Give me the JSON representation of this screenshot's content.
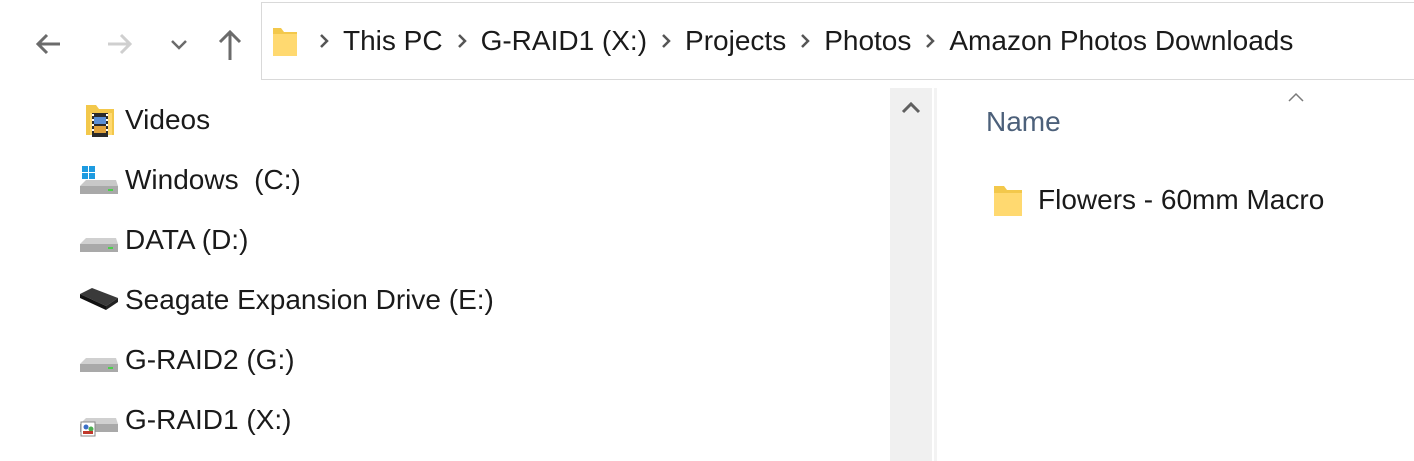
{
  "toolbar": {
    "back_icon": "arrow-left-icon",
    "forward_icon": "arrow-right-icon",
    "recent_icon": "chevron-down-icon",
    "up_icon": "arrow-up-icon"
  },
  "address": {
    "icon": "folder-icon",
    "crumbs": [
      "This PC",
      "G-RAID1 (X:)",
      "Projects",
      "Photos",
      "Amazon Photos Downloads"
    ]
  },
  "navigation": {
    "items": [
      {
        "label": "Videos",
        "icon": "videos-folder-icon"
      },
      {
        "label": "Windows  (C:)",
        "icon": "windows-drive-icon"
      },
      {
        "label": "DATA (D:)",
        "icon": "drive-icon"
      },
      {
        "label": "Seagate Expansion Drive (E:)",
        "icon": "external-drive-icon"
      },
      {
        "label": "G-RAID2 (G:)",
        "icon": "drive-icon"
      },
      {
        "label": "G-RAID1 (X:)",
        "icon": "network-drive-icon"
      }
    ]
  },
  "content": {
    "column_header": "Name",
    "sort": "ascending",
    "items": [
      {
        "name": "Flowers - 60mm Macro",
        "icon": "folder-icon"
      }
    ]
  },
  "colors": {
    "folder": "#f3c84b",
    "column_header_text": "#4c607a",
    "scrollbar_track": "#f0f0f0",
    "windows_logo": "#1e9be0"
  }
}
